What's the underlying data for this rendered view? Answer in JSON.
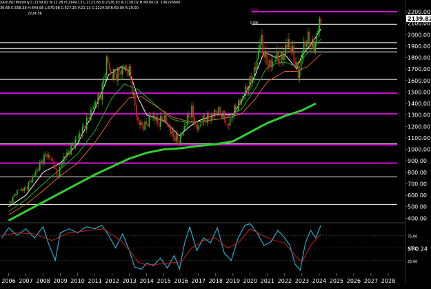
{
  "header": {
    "symbol_line": "XAUUSD Monthly  C:2139.82  N:12.28  H:2149.13  L:2123.66  O:2126.93  R:2138.02  H:49.6K  OI: 106195666",
    "indicator_line": "30:66  C:558.38  H:649.58  L:570.98  C:627.25  V:21 13  C:2224.58  R:69.09  R:29.00",
    "sub_line": "2224.56"
  },
  "chart_data": [
    {
      "type": "line",
      "subtype": "candlestick",
      "title": "XAUUSD Monthly",
      "xlabel": "",
      "ylabel": "",
      "x_ticks": [
        "2006",
        "2007",
        "2008",
        "2009",
        "2010",
        "2011",
        "2012",
        "2013",
        "2014",
        "2015",
        "2016",
        "2017",
        "2018",
        "2019",
        "2020",
        "2021",
        "2022",
        "2023",
        "2024",
        "2025",
        "2026",
        "2027",
        "2028"
      ],
      "y_ticks": [
        400,
        500,
        600,
        700,
        800,
        900,
        1000,
        1100,
        1200,
        1300,
        1400,
        1500,
        1600,
        1700,
        1800,
        1900,
        2000,
        2100,
        2200
      ],
      "ylim": [
        360,
        2230
      ],
      "last_price": "2139.82",
      "price_line": 2100,
      "series": [
        {
          "name": "",
          "kind": "close",
          "x": [
            2006.0,
            2006.5,
            2007.0,
            2007.5,
            2008.0,
            2008.2,
            2008.6,
            2008.8,
            2009.2,
            2009.6,
            2010.0,
            2010.5,
            2011.0,
            2011.4,
            2011.7,
            2011.9,
            2012.3,
            2012.7,
            2013.0,
            2013.3,
            2013.5,
            2013.9,
            2014.3,
            2014.7,
            2015.0,
            2015.5,
            2015.9,
            2016.3,
            2016.6,
            2016.9,
            2017.3,
            2017.7,
            2018.0,
            2018.4,
            2018.7,
            2019.0,
            2019.4,
            2019.7,
            2020.0,
            2020.3,
            2020.6,
            2020.9,
            2021.2,
            2021.5,
            2021.8,
            2022.2,
            2022.5,
            2022.8,
            2023.1,
            2023.4,
            2023.7,
            2023.9,
            2024.1
          ],
          "values": [
            520,
            640,
            660,
            780,
            920,
            960,
            880,
            760,
            930,
            1000,
            1100,
            1230,
            1400,
            1500,
            1800,
            1650,
            1660,
            1720,
            1670,
            1400,
            1230,
            1200,
            1300,
            1230,
            1280,
            1120,
            1070,
            1240,
            1340,
            1170,
            1260,
            1280,
            1340,
            1300,
            1200,
            1320,
            1400,
            1500,
            1580,
            1700,
            1970,
            1780,
            1730,
            1800,
            1780,
            1940,
            1820,
            1640,
            1910,
            1960,
            1870,
            2040,
            2140
          ]
        },
        {
          "name": "",
          "kind": "fast_ma",
          "x": [
            2006.0,
            2007.0,
            2008.0,
            2009.0,
            2010.0,
            2011.0,
            2011.8,
            2012.5,
            2013.0,
            2013.5,
            2014.0,
            2015.0,
            2015.9,
            2016.5,
            2017.0,
            2018.0,
            2019.0,
            2019.6,
            2020.3,
            2020.8,
            2021.5,
            2022.0,
            2022.7,
            2023.0,
            2023.6,
            2024.1
          ],
          "values": [
            500,
            600,
            800,
            880,
            1050,
            1350,
            1650,
            1720,
            1680,
            1450,
            1300,
            1250,
            1120,
            1200,
            1250,
            1300,
            1300,
            1450,
            1650,
            1850,
            1800,
            1830,
            1700,
            1820,
            1930,
            2050
          ]
        },
        {
          "name": "",
          "kind": "mid_ma",
          "x": [
            2006.0,
            2007.0,
            2008.0,
            2009.0,
            2010.0,
            2011.0,
            2012.0,
            2012.7,
            2013.5,
            2014.5,
            2015.5,
            2016.5,
            2017.5,
            2018.5,
            2019.5,
            2020.3,
            2020.9,
            2021.5,
            2022.0,
            2022.6,
            2023.0,
            2023.6,
            2024.1
          ],
          "values": [
            460,
            560,
            700,
            830,
            960,
            1160,
            1450,
            1570,
            1520,
            1390,
            1260,
            1230,
            1250,
            1270,
            1350,
            1530,
            1700,
            1750,
            1760,
            1730,
            1790,
            1880,
            1960
          ]
        },
        {
          "name": "",
          "kind": "slow_ma",
          "x": [
            2006.0,
            2007.0,
            2008.0,
            2009.0,
            2010.0,
            2011.0,
            2012.0,
            2013.0,
            2013.7,
            2014.5,
            2015.5,
            2016.5,
            2017.5,
            2018.5,
            2019.5,
            2020.3,
            2021.0,
            2022.0,
            2022.7,
            2023.3,
            2024.1
          ],
          "values": [
            430,
            520,
            640,
            770,
            880,
            1060,
            1280,
            1450,
            1460,
            1380,
            1280,
            1240,
            1250,
            1270,
            1310,
            1440,
            1590,
            1680,
            1680,
            1720,
            1830
          ]
        },
        {
          "name": "",
          "kind": "long_ma",
          "x": [
            2006.0,
            2007.0,
            2008.0,
            2009.0,
            2010.0,
            2011.0,
            2012.0,
            2013.0,
            2014.0,
            2015.0,
            2016.0,
            2017.0,
            2018.0,
            2019.0,
            2020.0,
            2021.0,
            2022.0,
            2023.0,
            2023.8
          ],
          "values": [
            380,
            460,
            540,
            620,
            700,
            780,
            850,
            920,
            970,
            1000,
            1010,
            1030,
            1045,
            1070,
            1150,
            1230,
            1290,
            1340,
            1400
          ]
        }
      ],
      "levels": [
        {
          "value": 2200,
          "color": "#d010d0",
          "label": "1.000"
        },
        {
          "value": 2090,
          "color": "#ffffff",
          "label": "0.000"
        },
        {
          "value": 1930,
          "color": "#ffffff",
          "label": ""
        },
        {
          "value": 1880,
          "color": "#ffffff",
          "label": ""
        },
        {
          "value": 1850,
          "color": "#ffffff",
          "label": ""
        },
        {
          "value": 1610,
          "color": "#ffffff",
          "label": ""
        },
        {
          "value": 1490,
          "color": "#d010d0",
          "label": ""
        },
        {
          "value": 1310,
          "color": "#d010d0",
          "label": ""
        },
        {
          "value": 1050,
          "color": "#ffffff",
          "label": ""
        },
        {
          "value": 1040,
          "color": "#d010d0",
          "label": ""
        },
        {
          "value": 880,
          "color": "#d010d0",
          "label": ""
        },
        {
          "value": 760,
          "color": "#ffffff",
          "label": ""
        },
        {
          "value": 520,
          "color": "#ffffff",
          "label": ""
        }
      ]
    },
    {
      "type": "line",
      "title": "",
      "label": "STO  24",
      "ylim": [
        0,
        100
      ],
      "y_ticks": [
        75,
        50,
        25
      ],
      "series": [
        {
          "name": "",
          "kind": "stochastic_k",
          "x": [
            2005.6,
            2006.0,
            2006.5,
            2007.0,
            2007.5,
            2008.0,
            2008.3,
            2008.7,
            2009.0,
            2009.5,
            2010.0,
            2010.5,
            2011.0,
            2011.4,
            2011.8,
            2012.2,
            2012.6,
            2013.0,
            2013.3,
            2013.7,
            2014.0,
            2014.4,
            2014.8,
            2015.2,
            2015.6,
            2015.9,
            2016.2,
            2016.5,
            2016.9,
            2017.3,
            2017.7,
            2018.1,
            2018.5,
            2018.9,
            2019.3,
            2019.7,
            2020.0,
            2020.4,
            2020.8,
            2021.2,
            2021.6,
            2022.0,
            2022.3,
            2022.6,
            2022.9,
            2023.2,
            2023.5,
            2023.8,
            2024.1
          ],
          "values": [
            70,
            90,
            75,
            88,
            70,
            92,
            60,
            25,
            80,
            88,
            80,
            92,
            88,
            95,
            75,
            50,
            78,
            45,
            12,
            8,
            20,
            15,
            30,
            10,
            35,
            8,
            60,
            92,
            45,
            70,
            60,
            90,
            40,
            25,
            70,
            95,
            98,
            80,
            55,
            62,
            85,
            70,
            55,
            18,
            6,
            60,
            85,
            70,
            95
          ]
        },
        {
          "name": "",
          "kind": "stochastic_d",
          "x": [
            2005.6,
            2006.5,
            2007.5,
            2008.5,
            2009.5,
            2010.5,
            2011.5,
            2012.5,
            2013.0,
            2013.5,
            2014.0,
            2014.7,
            2015.3,
            2016.0,
            2016.6,
            2017.3,
            2018.0,
            2018.7,
            2019.3,
            2020.0,
            2020.7,
            2021.4,
            2022.0,
            2022.6,
            2023.0,
            2023.5,
            2024.1
          ],
          "values": [
            75,
            80,
            78,
            65,
            80,
            84,
            88,
            65,
            45,
            22,
            16,
            18,
            20,
            22,
            50,
            65,
            70,
            50,
            60,
            88,
            75,
            65,
            60,
            35,
            22,
            55,
            78
          ]
        }
      ]
    }
  ]
}
